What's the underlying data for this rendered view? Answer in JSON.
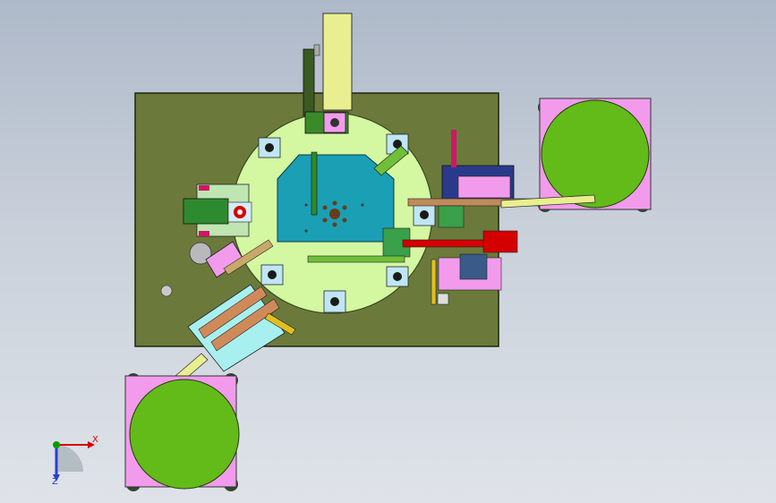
{
  "viewport": {
    "background_top": "#aeb9c9",
    "background_bottom": "#dfe3e9"
  },
  "colors": {
    "base_plate": "#6b7a3a",
    "turntable": "#d4f7a2",
    "center_plate": "#1a9fb5",
    "bowl_disc": "#63bb1a",
    "bowl_base": "#f29bec",
    "feed_track": "#e9ef8f",
    "x_axis": "#d40000",
    "y_axis": "#00a000",
    "z_axis": "#2a3fcf"
  },
  "triad": {
    "x_label": "X",
    "z_label": "Z"
  }
}
